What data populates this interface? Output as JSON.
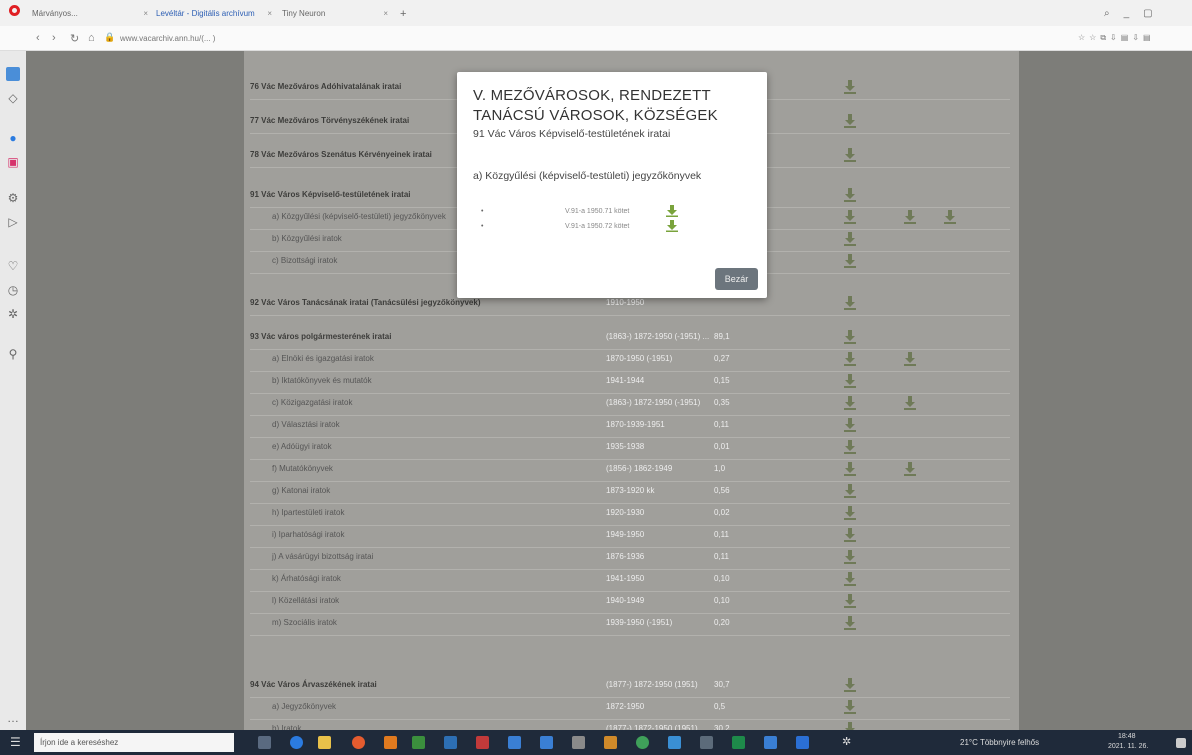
{
  "browser": {
    "tabs": [
      {
        "label": "Márványos...",
        "active": false
      },
      {
        "label": "Levéltár - Digitális archívum",
        "active": true
      },
      {
        "label": "Tiny Neuron",
        "active": false
      }
    ],
    "url": "www.vacarchiv.ann.hu/(... )"
  },
  "list": {
    "rows": [
      {
        "label": "76  Vác Mezőváros Adóhivatalának iratai",
        "years": "",
        "fm": "",
        "kind": "main"
      },
      {
        "label": "77  Vác Mezőváros Törvényszékének iratai",
        "years": "",
        "fm": "",
        "kind": "main"
      },
      {
        "label": "78  Vác Mezőváros Szenátus Kérvényeinek iratai",
        "years": "",
        "fm": "",
        "kind": "main"
      },
      {
        "label": "91  Vác Város Képviselő-testületének iratai",
        "years": "",
        "fm": "",
        "kind": "main"
      },
      {
        "label": "a) Közgyűlési (képviselő-testületi) jegyzőkönyvek",
        "years": "",
        "fm": "",
        "kind": "sub"
      },
      {
        "label": "b) Közgyűlési iratok",
        "years": "",
        "fm": "",
        "kind": "sub"
      },
      {
        "label": "c) Bizottsági iratok",
        "years": "",
        "fm": "",
        "kind": "sub"
      },
      {
        "label": "92  Vác Város Tanácsának iratai (Tanácsülési jegyzőkönyvek)",
        "years": "1910-1950",
        "fm": "",
        "kind": "main"
      },
      {
        "label": "93  Vác város polgármesterének iratai",
        "years": "(1863-) 1872-1950 (-1951) ...",
        "fm": "89,1",
        "kind": "main"
      },
      {
        "label": "a) Elnöki és igazgatási iratok",
        "years": "1870-1950 (-1951)",
        "fm": "0,27",
        "kind": "sub"
      },
      {
        "label": "b) Iktatókönyvek és mutatók",
        "years": "1941-1944",
        "fm": "0,15",
        "kind": "sub"
      },
      {
        "label": "c) Közigazgatási iratok",
        "years": "(1863-) 1872-1950 (-1951)",
        "fm": "0,35",
        "kind": "sub"
      },
      {
        "label": "d) Választási iratok",
        "years": "1870-1939-1951",
        "fm": "0,11",
        "kind": "sub"
      },
      {
        "label": "e) Adóügyi iratok",
        "years": "1935-1938",
        "fm": "0,01",
        "kind": "sub"
      },
      {
        "label": "f) Mutatókönyvek",
        "years": "(1856-) 1862-1949",
        "fm": "1,0",
        "kind": "sub"
      },
      {
        "label": "g) Katonai iratok",
        "years": "1873-1920 kk",
        "fm": "0,56",
        "kind": "sub"
      },
      {
        "label": "h) Ipartestületi iratok",
        "years": "1920-1930",
        "fm": "0,02",
        "kind": "sub"
      },
      {
        "label": "i) Iparhatósági iratok",
        "years": "1949-1950",
        "fm": "0,11",
        "kind": "sub"
      },
      {
        "label": "j) A vásárügyi bizottság iratai",
        "years": "1876-1936",
        "fm": "0,11",
        "kind": "sub"
      },
      {
        "label": "k) Árhatósági iratok",
        "years": "1941-1950",
        "fm": "0,10",
        "kind": "sub"
      },
      {
        "label": "l) Közellátási iratok",
        "years": "1940-1949",
        "fm": "0,10",
        "kind": "sub"
      },
      {
        "label": "m) Szociális iratok",
        "years": "1939-1950 (-1951)",
        "fm": "0,20",
        "kind": "sub"
      },
      {
        "label": "94  Vác Város Árvaszékének iratai",
        "years": "(1877-) 1872-1950 (1951)",
        "fm": "30,7",
        "kind": "main"
      },
      {
        "label": "a) Jegyzőkönyvek",
        "years": "1872-1950",
        "fm": "0,5",
        "kind": "sub"
      },
      {
        "label": "b) Iratok",
        "years": "(1877-) 1872-1950 (1951)",
        "fm": "30,2",
        "kind": "sub"
      }
    ]
  },
  "modal": {
    "title": "V. MEZŐVÁROSOK, RENDEZETT TANÁCSÚ VÁROSOK, KÖZSÉGEK",
    "subtitle": "91 Vác Város Képviselő-testületének iratai",
    "section": "a) Közgyűlési (képviselő-testületi) jegyzőkönyvek",
    "items": [
      {
        "bullet": "•",
        "text": "V.91-a 1950.71 kötet"
      },
      {
        "bullet": "•",
        "text": "V.91-a 1950.72 kötet"
      }
    ],
    "close_label": "Bezár"
  },
  "taskbar": {
    "search_placeholder": "Írjon ide a kereséshez",
    "weather": "21°C Többnyire felhős",
    "time": "18:48",
    "date": "2021. 11. 26."
  },
  "colors": {
    "download_green": "#7aa33c",
    "overlay": "#7d7d79",
    "close_button": "#6c757d"
  }
}
